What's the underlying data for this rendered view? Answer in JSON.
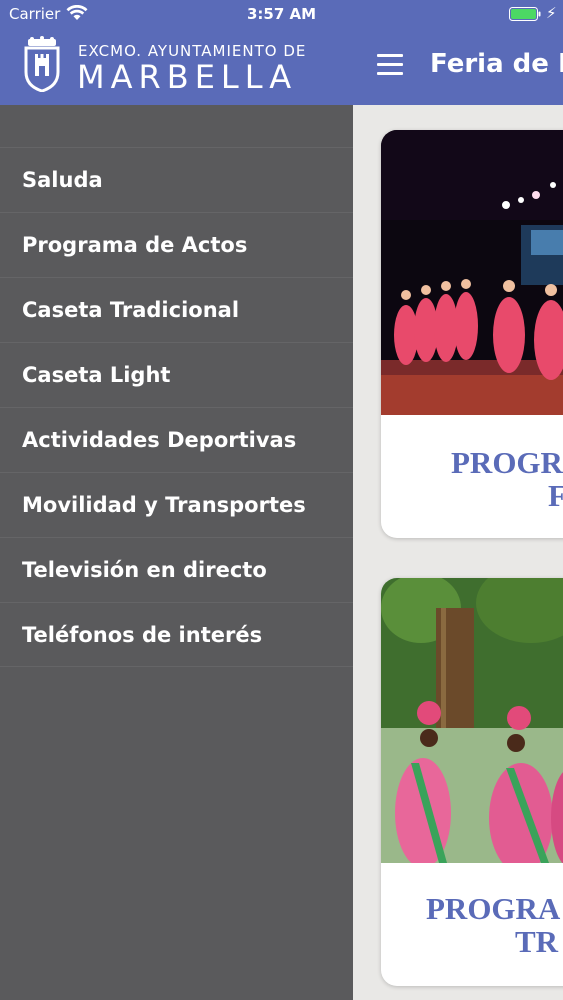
{
  "status_bar": {
    "carrier": "Carrier",
    "time": "3:57 AM",
    "wifi_icon": "wifi-icon",
    "battery_icon": "battery-icon"
  },
  "drawer": {
    "brand_top": "EXCMO. AYUNTAMIENTO DE",
    "brand_main": "MARBELLA",
    "logo_icon": "marbella-crest-icon",
    "items": [
      {
        "label": "Saluda"
      },
      {
        "label": "Programa de Actos"
      },
      {
        "label": "Caseta Tradicional"
      },
      {
        "label": "Caseta Light"
      },
      {
        "label": "Actividades Deportivas"
      },
      {
        "label": "Movilidad y Transportes"
      },
      {
        "label": "Televisión en directo"
      },
      {
        "label": "Teléfonos de interés"
      }
    ]
  },
  "main": {
    "title": "Feria de M",
    "menu_icon": "hamburger-icon",
    "cards": [
      {
        "title_line1": "PROGR",
        "title_line2": "F",
        "image": "flamenco-dancers-stage-photo"
      },
      {
        "title_line1": "PROGRA",
        "title_line2": "TR",
        "image": "flamenco-women-park-photo"
      }
    ]
  },
  "colors": {
    "brand_blue": "#5a6bb8",
    "drawer_bg": "#5a5a5c",
    "card_title": "#5a6bb8"
  }
}
